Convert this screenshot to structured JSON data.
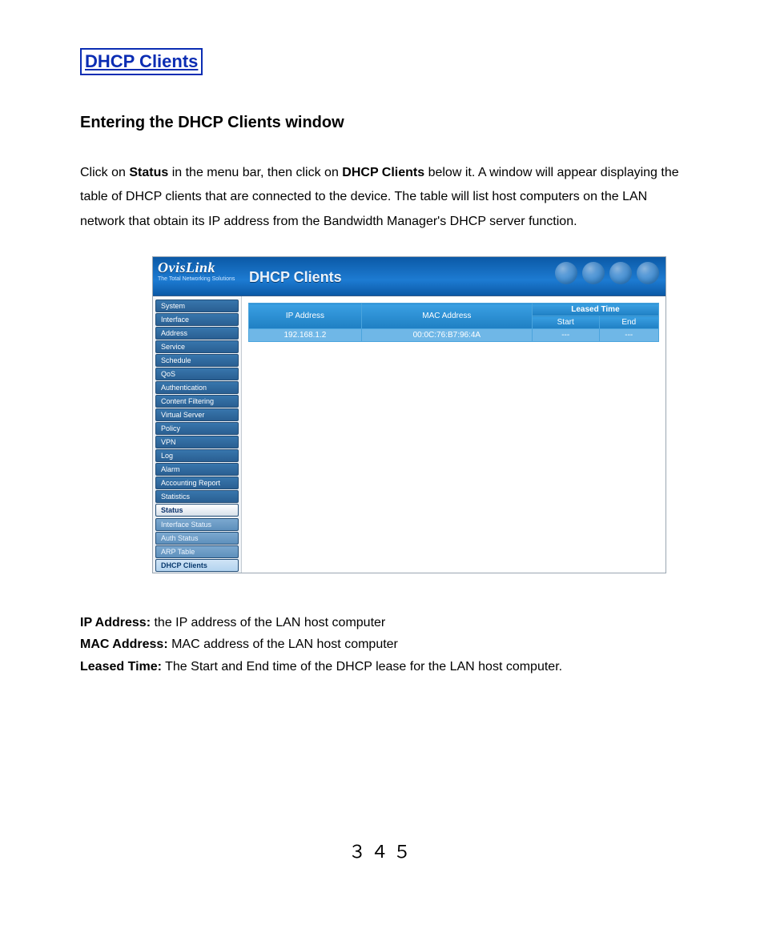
{
  "doc": {
    "title": "DHCP Clients",
    "subtitle": "Entering the DHCP Clients window",
    "body_parts": {
      "p1a": "Click on ",
      "p1b": "Status",
      "p1c": " in the menu bar, then click on ",
      "p1d": "DHCP Clients",
      "p1e": " below it.    A window will appear displaying the table of DHCP clients that are connected to the device.    The table will list host computers on the LAN network that obtain its IP address from the Bandwidth Manager's DHCP server function."
    },
    "defs": {
      "ip_label": "IP Address:",
      "ip_text": "   the IP address of the LAN host computer",
      "mac_label": "MAC Address:",
      "mac_text": "   MAC address of the LAN host computer",
      "lease_label": "Leased Time:",
      "lease_text": "   The Start and End time of the DHCP lease for the LAN host computer."
    },
    "page_number": "３４５"
  },
  "shot": {
    "brand": "OvisLink",
    "brand_sub": "The Total Networking Solutions",
    "page_title": "DHCP Clients",
    "sidebar": {
      "items": [
        "System",
        "Interface",
        "Address",
        "Service",
        "Schedule",
        "QoS",
        "Authentication",
        "Content Filtering",
        "Virtual Server",
        "Policy",
        "VPN",
        "Log",
        "Alarm",
        "Accounting Report",
        "Statistics",
        "Status"
      ],
      "selected": "Status",
      "sub_items": [
        "Interface Status",
        "Auth Status",
        "ARP Table",
        "DHCP Clients"
      ],
      "sub_selected": "DHCP Clients"
    },
    "table": {
      "headers": {
        "ip": "IP Address",
        "mac": "MAC Address",
        "leased": "Leased Time",
        "start": "Start",
        "end": "End"
      },
      "rows": [
        {
          "ip": "192.168.1.2",
          "mac": "00:0C:76:B7:96:4A",
          "start": "---",
          "end": "---"
        }
      ]
    }
  }
}
